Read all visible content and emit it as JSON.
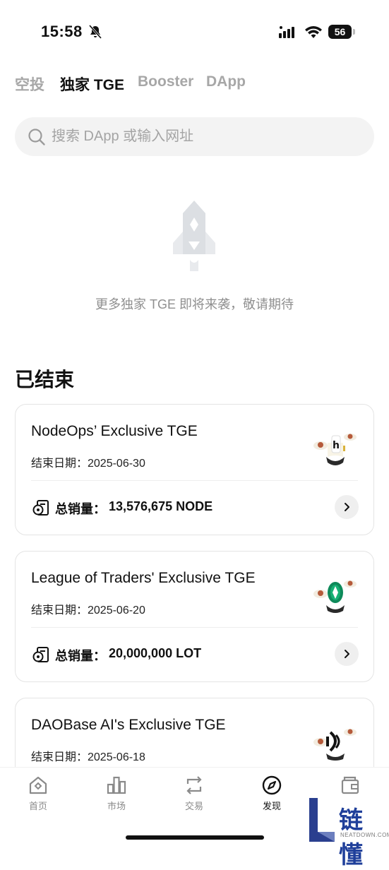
{
  "status_bar": {
    "time": "15:58",
    "battery": "56"
  },
  "tabs": [
    {
      "label": "空投",
      "active": false
    },
    {
      "label": "独家 TGE",
      "active": true
    },
    {
      "label": "Booster",
      "active": false
    },
    {
      "label": "DApp",
      "active": false
    }
  ],
  "search": {
    "placeholder": "搜索 DApp 或输入网址"
  },
  "empty_state": {
    "text": "更多独家 TGE 即将来袭，敬请期待"
  },
  "section": {
    "title": "已结束"
  },
  "cards": [
    {
      "title": "NodeOps’ Exclusive TGE",
      "date": "结束日期：2025-06-30",
      "sales_label": "总销量：",
      "sales_value": "13,576,675 NODE"
    },
    {
      "title": "League of Traders' Exclusive TGE",
      "date": "结束日期：2025-06-20",
      "sales_label": "总销量：",
      "sales_value": "20,000,000 LOT"
    },
    {
      "title": "DAOBase AI's Exclusive TGE",
      "date": "结束日期：2025-06-18"
    }
  ],
  "bottom_nav": [
    {
      "label": "首页",
      "icon": "home-icon",
      "active": false
    },
    {
      "label": "市场",
      "icon": "market-icon",
      "active": false
    },
    {
      "label": "交易",
      "icon": "trade-icon",
      "active": false
    },
    {
      "label": "发现",
      "icon": "discover-icon",
      "active": true
    },
    {
      "label": "资产",
      "icon": "wallet-icon",
      "active": false
    }
  ],
  "watermark": {
    "text": "链懂",
    "sub": "NEATDOWN.COM"
  }
}
